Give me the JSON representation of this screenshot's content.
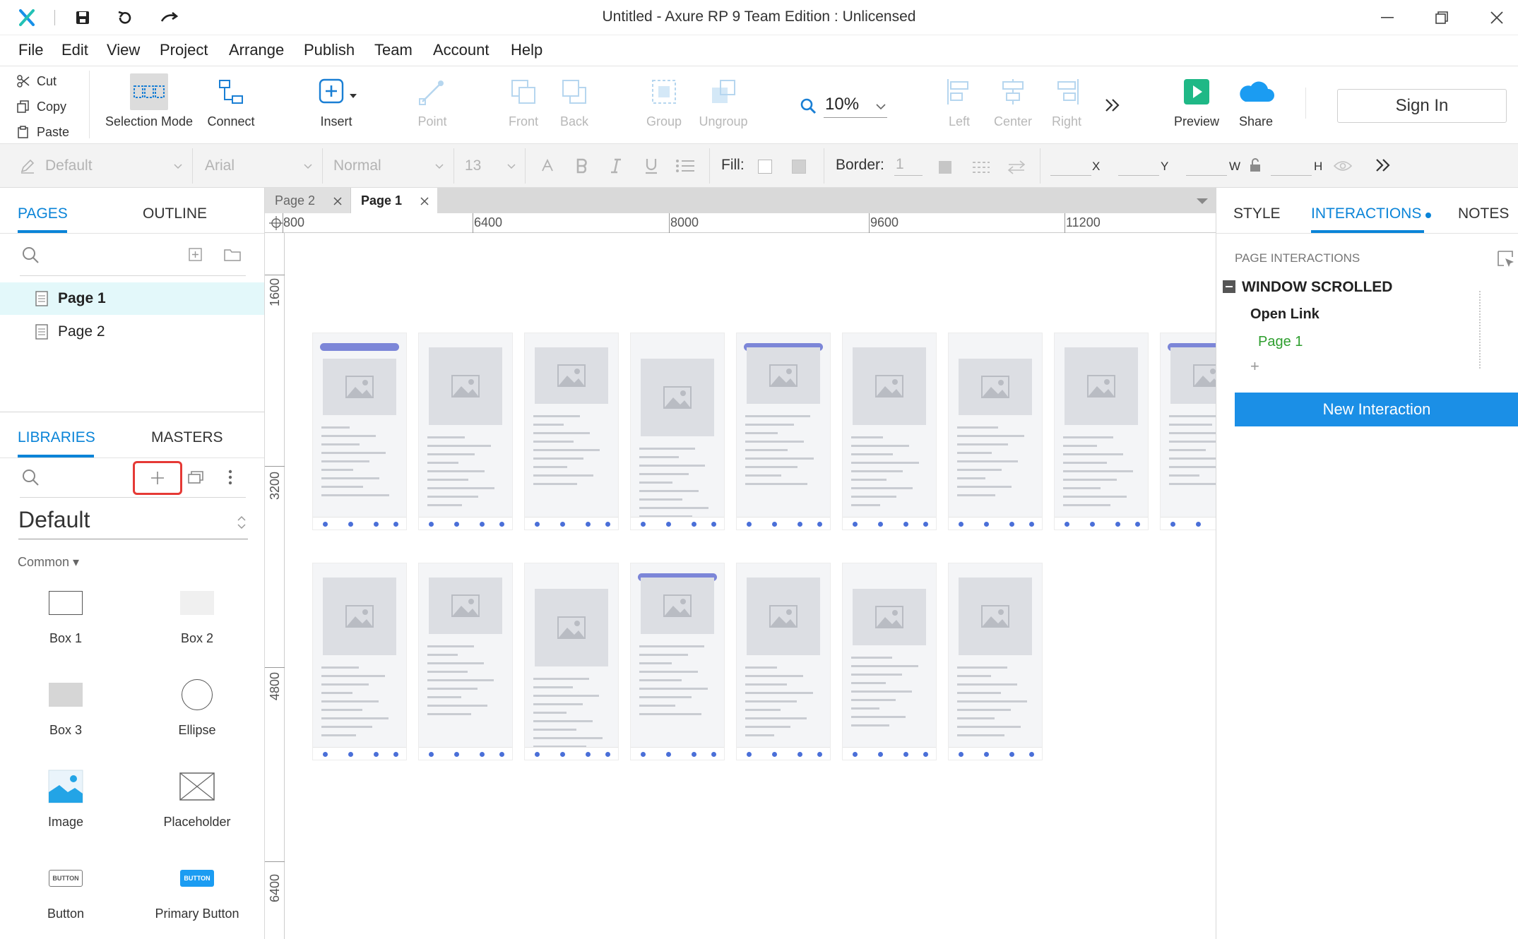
{
  "window": {
    "title": "Untitled - Axure RP 9 Team Edition : Unlicensed"
  },
  "menu": [
    "File",
    "Edit",
    "View",
    "Project",
    "Arrange",
    "Publish",
    "Team",
    "Account",
    "Help"
  ],
  "clipboard": {
    "cut": "Cut",
    "copy": "Copy",
    "paste": "Paste"
  },
  "toolbar": {
    "selection_mode": "Selection Mode",
    "connect": "Connect",
    "insert": "Insert",
    "point": "Point",
    "front": "Front",
    "back": "Back",
    "group": "Group",
    "ungroup": "Ungroup",
    "zoom": "10%",
    "left": "Left",
    "center": "Center",
    "right": "Right",
    "preview": "Preview",
    "share": "Share",
    "sign_in": "Sign In"
  },
  "format": {
    "style": "Default",
    "font": "Arial",
    "weight": "Normal",
    "size": "13",
    "fill_label": "Fill:",
    "border_label": "Border:",
    "border_value": "1",
    "x": "X",
    "y": "Y",
    "w": "W",
    "h": "H"
  },
  "left_panel": {
    "tabs": {
      "pages": "PAGES",
      "outline": "OUTLINE"
    },
    "pages": [
      "Page 1",
      "Page 2"
    ],
    "lib_tabs": {
      "libraries": "LIBRARIES",
      "masters": "MASTERS"
    },
    "library_name": "Default",
    "section": "Common ▾",
    "items": [
      "Box 1",
      "Box 2",
      "Box 3",
      "Ellipse",
      "Image",
      "Placeholder",
      "Button",
      "Primary Button"
    ],
    "button_text": "BUTTON"
  },
  "doc_tabs": [
    "Page 2",
    "Page 1"
  ],
  "rulers": {
    "h": [
      "800",
      "6400",
      "8000",
      "9600",
      "11200"
    ],
    "v": [
      "1600",
      "3200",
      "4800",
      "6400"
    ]
  },
  "right_panel": {
    "tabs": {
      "style": "STYLE",
      "interactions": "INTERACTIONS",
      "notes": "NOTES"
    },
    "heading": "PAGE INTERACTIONS",
    "event": "WINDOW SCROLLED",
    "action": "Open Link",
    "target": "Page 1",
    "add": "+",
    "new_interaction": "New Interaction"
  },
  "colors": {
    "accent": "#0a84d8",
    "highlight_box": "#e53935",
    "preview_green": "#1fb886",
    "share_blue": "#1b9cf2",
    "link_green": "#2e9e2e",
    "selected_row": "#e3f8fa"
  }
}
